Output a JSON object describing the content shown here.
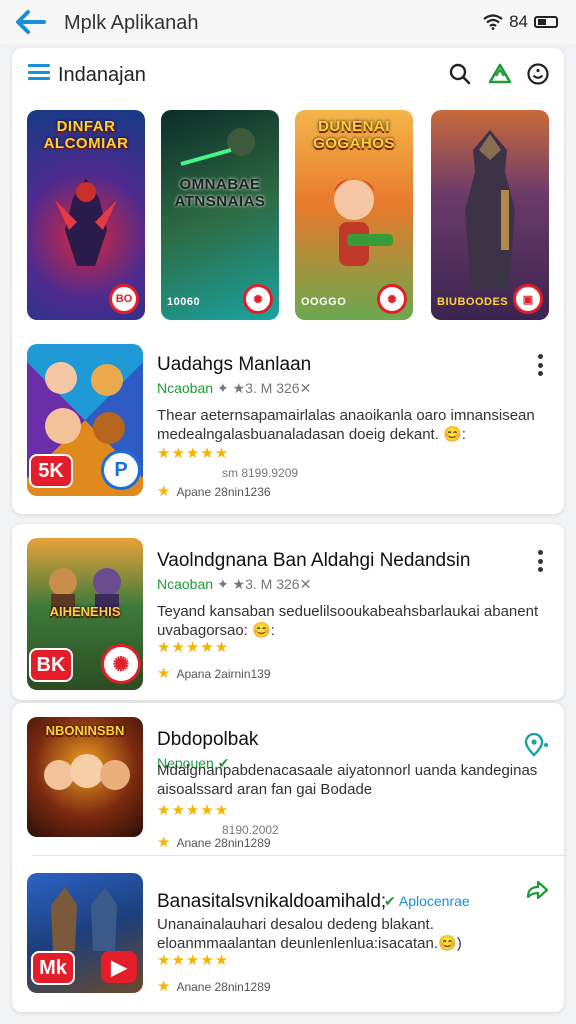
{
  "status_bar": {
    "app_title": "Mplk Aplikanah",
    "time": "84"
  },
  "toolbar": {
    "title": "Indanajan"
  },
  "featured": [
    {
      "title": "DINFAR ALCOMIAR",
      "label": "",
      "badge": "BO",
      "colors": [
        "#143a86",
        "#4e2b8e",
        "#d7263d"
      ]
    },
    {
      "title": "OMNABAE ATNSNAIAS",
      "label": "10060",
      "badge": "✺",
      "colors": [
        "#0d2c2a",
        "#2d6b43",
        "#1aa3a0"
      ]
    },
    {
      "title": "DUNENAI GOGAHOS",
      "label": "OOGGO",
      "badge": "✺",
      "colors": [
        "#f4b64a",
        "#e87a2c",
        "#6aa84f"
      ]
    },
    {
      "title": "",
      "label": "BIUBOODES",
      "badge": "▣",
      "colors": [
        "#3b2450",
        "#6c3b6a",
        "#c96a3a"
      ]
    }
  ],
  "apps": [
    {
      "name": "Uadahgs Manlaan",
      "developer": "Ncaoban",
      "developer_meta": "✦ ★3.  M 326✕",
      "description": "Thear aeternsapamairlalas anaoikanla oaro imnansisean medealngalasbuanaladasan doeig dekant. 😊:",
      "stars": "★★★★★",
      "size": "sm 8199.9209",
      "rating_text": "Apane 28nin1236",
      "thumb_title": "",
      "badge_left": "5K",
      "badge_right": "P"
    },
    {
      "name": "Vaolndgnana Ban Aldahgi Nedandsin",
      "developer": "Ncaoban",
      "developer_meta": "✦ ★3.  M 326✕",
      "description": "Teyand kansaban seduelilsooukabeahsbarlaukai abanent uvabagorsao: 😊:",
      "stars": "★★★★★",
      "size": "",
      "rating_text": "Apana 2airnin139",
      "thumb_title": "AIHENEHIS",
      "badge_left": "BK",
      "badge_right": "✺"
    },
    {
      "name": "Dbdopolbak",
      "developer": "Nepouen",
      "developer_meta": "",
      "description": "Mdalgnanpabdenacasaale aiyatonnorl uanda kandeginas aisoalssard aran fan gai Bodade",
      "stars": "★★★★★",
      "size": "8190.2002",
      "rating_text": "Anane 28nin1289",
      "thumb_title": "NBONINSBN",
      "badge_left": "",
      "badge_right": ""
    },
    {
      "name": "Banasitalsvnikaldoamihald;",
      "developer": "Aplocenrae",
      "developer_meta": "",
      "description": "Unanainalauhari desalou dedeng blakant. eloanmmaalantan deunlenlenlua:isacatan.😊)",
      "stars": "★★★★★",
      "size": "",
      "rating_text": "Anane 28nin1289",
      "thumb_title": "",
      "badge_left": "Mk",
      "badge_right": "▶"
    }
  ],
  "colors": {
    "accent_blue": "#1a8fd8",
    "green": "#1f9a3a",
    "red_badge": "#e31e2a",
    "star": "#f5b400"
  }
}
